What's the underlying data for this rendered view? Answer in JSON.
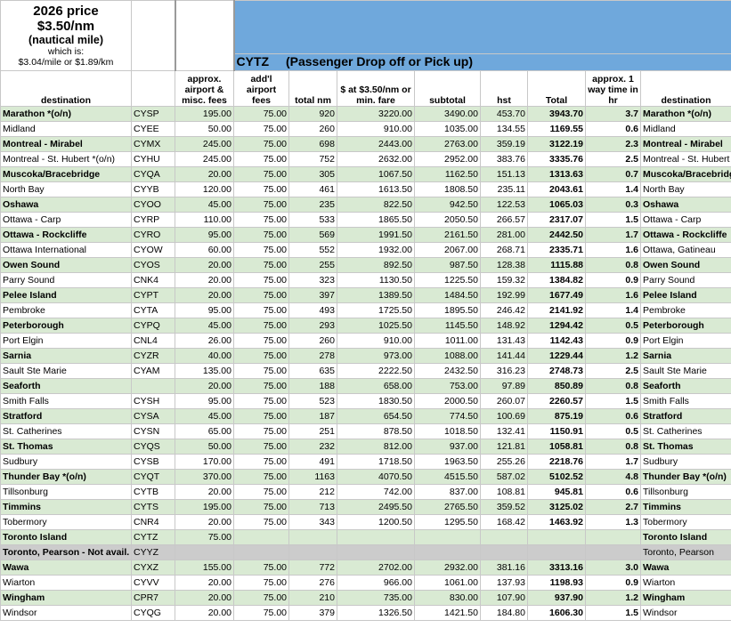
{
  "price_box": {
    "line1": "2026 price",
    "line2": "$3.50/nm",
    "line3": "(nautical mile)",
    "line4": "which is:",
    "line5": "$3.04/mile or $1.89/km"
  },
  "banner": {
    "code": "CYTZ",
    "subtitle": "(Passenger Drop off or Pick up)"
  },
  "headers": {
    "destination": "destination",
    "code": "",
    "airport_fees": "approx. airport & misc. fees",
    "addl_fees": "add'l airport fees",
    "total_nm": "total nm",
    "fare": "$ at $3.50/nm or min. fare",
    "subtotal": "subtotal",
    "hst": "hst",
    "total": "Total",
    "time": "approx. 1 way time in hr",
    "destination2": "destination"
  },
  "colors": {
    "green": "#d9ead3",
    "grey": "#cccccc",
    "banner_blue": "#6fa8dc"
  },
  "rows": [
    {
      "style": "green",
      "dest": "Marathon *(o/n)",
      "code": "CYSP",
      "fees": "195.00",
      "addl": "75.00",
      "nm": "920",
      "fare": "3220.00",
      "subtotal": "3490.00",
      "hst": "453.70",
      "total": "3943.70",
      "time": "3.7",
      "dest2": "Marathon *(o/n)"
    },
    {
      "style": "white",
      "dest": "Midland",
      "code": "CYEE",
      "fees": "50.00",
      "addl": "75.00",
      "nm": "260",
      "fare": "910.00",
      "subtotal": "1035.00",
      "hst": "134.55",
      "total": "1169.55",
      "time": "0.6",
      "dest2": "Midland"
    },
    {
      "style": "green",
      "dest": "Montreal - Mirabel",
      "code": "CYMX",
      "fees": "245.00",
      "addl": "75.00",
      "nm": "698",
      "fare": "2443.00",
      "subtotal": "2763.00",
      "hst": "359.19",
      "total": "3122.19",
      "time": "2.3",
      "dest2": "Montreal - Mirabel"
    },
    {
      "style": "white",
      "dest": "Montreal - St. Hubert *(o/n)",
      "code": "CYHU",
      "fees": "245.00",
      "addl": "75.00",
      "nm": "752",
      "fare": "2632.00",
      "subtotal": "2952.00",
      "hst": "383.76",
      "total": "3335.76",
      "time": "2.5",
      "dest2": "Montreal - St. Hubert"
    },
    {
      "style": "green",
      "dest": "Muscoka/Bracebridge",
      "code": "CYQA",
      "fees": "20.00",
      "addl": "75.00",
      "nm": "305",
      "fare": "1067.50",
      "subtotal": "1162.50",
      "hst": "151.13",
      "total": "1313.63",
      "time": "0.7",
      "dest2": "Muscoka/Bracebridge"
    },
    {
      "style": "white",
      "dest": "North Bay",
      "code": "CYYB",
      "fees": "120.00",
      "addl": "75.00",
      "nm": "461",
      "fare": "1613.50",
      "subtotal": "1808.50",
      "hst": "235.11",
      "total": "2043.61",
      "time": "1.4",
      "dest2": "North Bay"
    },
    {
      "style": "green",
      "dest": "Oshawa",
      "code": "CYOO",
      "fees": "45.00",
      "addl": "75.00",
      "nm": "235",
      "fare": "822.50",
      "subtotal": "942.50",
      "hst": "122.53",
      "total": "1065.03",
      "time": "0.3",
      "dest2": "Oshawa"
    },
    {
      "style": "white",
      "dest": "Ottawa - Carp",
      "code": "CYRP",
      "fees": "110.00",
      "addl": "75.00",
      "nm": "533",
      "fare": "1865.50",
      "subtotal": "2050.50",
      "hst": "266.57",
      "total": "2317.07",
      "time": "1.5",
      "dest2": "Ottawa - Carp"
    },
    {
      "style": "green",
      "dest": "Ottawa - Rockcliffe",
      "code": "CYRO",
      "fees": "95.00",
      "addl": "75.00",
      "nm": "569",
      "fare": "1991.50",
      "subtotal": "2161.50",
      "hst": "281.00",
      "total": "2442.50",
      "time": "1.7",
      "dest2": "Ottawa - Rockcliffe"
    },
    {
      "style": "white",
      "dest": "Ottawa International",
      "code": "CYOW",
      "fees": "60.00",
      "addl": "75.00",
      "nm": "552",
      "fare": "1932.00",
      "subtotal": "2067.00",
      "hst": "268.71",
      "total": "2335.71",
      "time": "1.6",
      "dest2": "Ottawa, Gatineau"
    },
    {
      "style": "green",
      "dest": "Owen Sound",
      "code": "CYOS",
      "fees": "20.00",
      "addl": "75.00",
      "nm": "255",
      "fare": "892.50",
      "subtotal": "987.50",
      "hst": "128.38",
      "total": "1115.88",
      "time": "0.8",
      "dest2": "Owen Sound"
    },
    {
      "style": "white",
      "dest": "Parry Sound",
      "code": "CNK4",
      "fees": "20.00",
      "addl": "75.00",
      "nm": "323",
      "fare": "1130.50",
      "subtotal": "1225.50",
      "hst": "159.32",
      "total": "1384.82",
      "time": "0.9",
      "dest2": "Parry Sound"
    },
    {
      "style": "green",
      "dest": "Pelee Island",
      "code": "CYPT",
      "fees": "20.00",
      "addl": "75.00",
      "nm": "397",
      "fare": "1389.50",
      "subtotal": "1484.50",
      "hst": "192.99",
      "total": "1677.49",
      "time": "1.6",
      "dest2": "Pelee Island"
    },
    {
      "style": "white",
      "dest": "Pembroke",
      "code": "CYTA",
      "fees": "95.00",
      "addl": "75.00",
      "nm": "493",
      "fare": "1725.50",
      "subtotal": "1895.50",
      "hst": "246.42",
      "total": "2141.92",
      "time": "1.4",
      "dest2": "Pembroke"
    },
    {
      "style": "green",
      "dest": "Peterborough",
      "code": "CYPQ",
      "fees": "45.00",
      "addl": "75.00",
      "nm": "293",
      "fare": "1025.50",
      "subtotal": "1145.50",
      "hst": "148.92",
      "total": "1294.42",
      "time": "0.5",
      "dest2": "Peterborough"
    },
    {
      "style": "white",
      "dest": "Port Elgin",
      "code": "CNL4",
      "fees": "26.00",
      "addl": "75.00",
      "nm": "260",
      "fare": "910.00",
      "subtotal": "1011.00",
      "hst": "131.43",
      "total": "1142.43",
      "time": "0.9",
      "dest2": "Port Elgin"
    },
    {
      "style": "green",
      "dest": "Sarnia",
      "code": "CYZR",
      "fees": "40.00",
      "addl": "75.00",
      "nm": "278",
      "fare": "973.00",
      "subtotal": "1088.00",
      "hst": "141.44",
      "total": "1229.44",
      "time": "1.2",
      "dest2": "Sarnia"
    },
    {
      "style": "white",
      "dest": "Sault Ste Marie",
      "code": "CYAM",
      "fees": "135.00",
      "addl": "75.00",
      "nm": "635",
      "fare": "2222.50",
      "subtotal": "2432.50",
      "hst": "316.23",
      "total": "2748.73",
      "time": "2.5",
      "dest2": "Sault Ste Marie"
    },
    {
      "style": "green",
      "dest": "Seaforth",
      "code": "",
      "fees": "20.00",
      "addl": "75.00",
      "nm": "188",
      "fare": "658.00",
      "subtotal": "753.00",
      "hst": "97.89",
      "total": "850.89",
      "time": "0.8",
      "dest2": "Seaforth"
    },
    {
      "style": "white",
      "dest": "Smith Falls",
      "code": "CYSH",
      "fees": "95.00",
      "addl": "75.00",
      "nm": "523",
      "fare": "1830.50",
      "subtotal": "2000.50",
      "hst": "260.07",
      "total": "2260.57",
      "time": "1.5",
      "dest2": "Smith Falls"
    },
    {
      "style": "green",
      "dest": "Stratford",
      "code": "CYSA",
      "fees": "45.00",
      "addl": "75.00",
      "nm": "187",
      "fare": "654.50",
      "subtotal": "774.50",
      "hst": "100.69",
      "total": "875.19",
      "time": "0.6",
      "dest2": "Stratford"
    },
    {
      "style": "white",
      "dest": "St. Catherines",
      "code": "CYSN",
      "fees": "65.00",
      "addl": "75.00",
      "nm": "251",
      "fare": "878.50",
      "subtotal": "1018.50",
      "hst": "132.41",
      "total": "1150.91",
      "time": "0.5",
      "dest2": "St. Catherines"
    },
    {
      "style": "green",
      "dest": "St. Thomas",
      "code": "CYQS",
      "fees": "50.00",
      "addl": "75.00",
      "nm": "232",
      "fare": "812.00",
      "subtotal": "937.00",
      "hst": "121.81",
      "total": "1058.81",
      "time": "0.8",
      "dest2": "St. Thomas"
    },
    {
      "style": "white",
      "dest": "Sudbury",
      "code": "CYSB",
      "fees": "170.00",
      "addl": "75.00",
      "nm": "491",
      "fare": "1718.50",
      "subtotal": "1963.50",
      "hst": "255.26",
      "total": "2218.76",
      "time": "1.7",
      "dest2": "Sudbury"
    },
    {
      "style": "green",
      "dest": "Thunder Bay *(o/n)",
      "code": "CYQT",
      "fees": "370.00",
      "addl": "75.00",
      "nm": "1163",
      "fare": "4070.50",
      "subtotal": "4515.50",
      "hst": "587.02",
      "total": "5102.52",
      "time": "4.8",
      "dest2": "Thunder Bay *(o/n)"
    },
    {
      "style": "white",
      "dest": "Tillsonburg",
      "code": "CYTB",
      "fees": "20.00",
      "addl": "75.00",
      "nm": "212",
      "fare": "742.00",
      "subtotal": "837.00",
      "hst": "108.81",
      "total": "945.81",
      "time": "0.6",
      "dest2": "Tillsonburg"
    },
    {
      "style": "green",
      "dest": "Timmins",
      "code": "CYTS",
      "fees": "195.00",
      "addl": "75.00",
      "nm": "713",
      "fare": "2495.50",
      "subtotal": "2765.50",
      "hst": "359.52",
      "total": "3125.02",
      "time": "2.7",
      "dest2": "Timmins"
    },
    {
      "style": "white",
      "dest": "Tobermory",
      "code": "CNR4",
      "fees": "20.00",
      "addl": "75.00",
      "nm": "343",
      "fare": "1200.50",
      "subtotal": "1295.50",
      "hst": "168.42",
      "total": "1463.92",
      "time": "1.3",
      "dest2": "Tobermory"
    },
    {
      "style": "green",
      "dest": "Toronto Island",
      "code": "CYTZ",
      "fees": "75.00",
      "addl": "",
      "nm": "",
      "fare": "",
      "subtotal": "",
      "hst": "",
      "total": "",
      "time": "",
      "dest2": "Toronto Island"
    },
    {
      "style": "grey",
      "dest": "Toronto, Pearson - Not avail.",
      "code": "CYYZ",
      "fees": "",
      "addl": "",
      "nm": "",
      "fare": "",
      "subtotal": "",
      "hst": "",
      "total": "",
      "time": "",
      "dest2": "Toronto, Pearson"
    },
    {
      "style": "green",
      "dest": "Wawa",
      "code": "CYXZ",
      "fees": "155.00",
      "addl": "75.00",
      "nm": "772",
      "fare": "2702.00",
      "subtotal": "2932.00",
      "hst": "381.16",
      "total": "3313.16",
      "time": "3.0",
      "dest2": "Wawa"
    },
    {
      "style": "white",
      "dest": "Wiarton",
      "code": "CYVV",
      "fees": "20.00",
      "addl": "75.00",
      "nm": "276",
      "fare": "966.00",
      "subtotal": "1061.00",
      "hst": "137.93",
      "total": "1198.93",
      "time": "0.9",
      "dest2": "Wiarton"
    },
    {
      "style": "green",
      "dest": "Wingham",
      "code": "CPR7",
      "fees": "20.00",
      "addl": "75.00",
      "nm": "210",
      "fare": "735.00",
      "subtotal": "830.00",
      "hst": "107.90",
      "total": "937.90",
      "time": "1.2",
      "dest2": "Wingham"
    },
    {
      "style": "white",
      "dest": "Windsor",
      "code": "CYQG",
      "fees": "20.00",
      "addl": "75.00",
      "nm": "379",
      "fare": "1326.50",
      "subtotal": "1421.50",
      "hst": "184.80",
      "total": "1606.30",
      "time": "1.5",
      "dest2": "Windsor"
    }
  ]
}
